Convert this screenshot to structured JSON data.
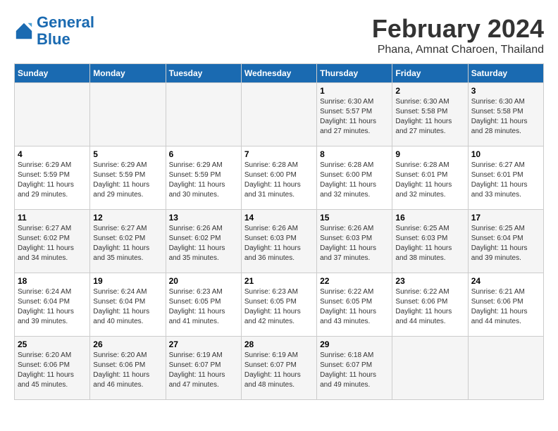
{
  "logo": {
    "text_general": "General",
    "text_blue": "Blue"
  },
  "title": "February 2024",
  "subtitle": "Phana, Amnat Charoen, Thailand",
  "weekdays": [
    "Sunday",
    "Monday",
    "Tuesday",
    "Wednesday",
    "Thursday",
    "Friday",
    "Saturday"
  ],
  "weeks": [
    [
      {
        "day": "",
        "info": ""
      },
      {
        "day": "",
        "info": ""
      },
      {
        "day": "",
        "info": ""
      },
      {
        "day": "",
        "info": ""
      },
      {
        "day": "1",
        "info": "Sunrise: 6:30 AM\nSunset: 5:57 PM\nDaylight: 11 hours and 27 minutes."
      },
      {
        "day": "2",
        "info": "Sunrise: 6:30 AM\nSunset: 5:58 PM\nDaylight: 11 hours and 27 minutes."
      },
      {
        "day": "3",
        "info": "Sunrise: 6:30 AM\nSunset: 5:58 PM\nDaylight: 11 hours and 28 minutes."
      }
    ],
    [
      {
        "day": "4",
        "info": "Sunrise: 6:29 AM\nSunset: 5:59 PM\nDaylight: 11 hours and 29 minutes."
      },
      {
        "day": "5",
        "info": "Sunrise: 6:29 AM\nSunset: 5:59 PM\nDaylight: 11 hours and 29 minutes."
      },
      {
        "day": "6",
        "info": "Sunrise: 6:29 AM\nSunset: 5:59 PM\nDaylight: 11 hours and 30 minutes."
      },
      {
        "day": "7",
        "info": "Sunrise: 6:28 AM\nSunset: 6:00 PM\nDaylight: 11 hours and 31 minutes."
      },
      {
        "day": "8",
        "info": "Sunrise: 6:28 AM\nSunset: 6:00 PM\nDaylight: 11 hours and 32 minutes."
      },
      {
        "day": "9",
        "info": "Sunrise: 6:28 AM\nSunset: 6:01 PM\nDaylight: 11 hours and 32 minutes."
      },
      {
        "day": "10",
        "info": "Sunrise: 6:27 AM\nSunset: 6:01 PM\nDaylight: 11 hours and 33 minutes."
      }
    ],
    [
      {
        "day": "11",
        "info": "Sunrise: 6:27 AM\nSunset: 6:02 PM\nDaylight: 11 hours and 34 minutes."
      },
      {
        "day": "12",
        "info": "Sunrise: 6:27 AM\nSunset: 6:02 PM\nDaylight: 11 hours and 35 minutes."
      },
      {
        "day": "13",
        "info": "Sunrise: 6:26 AM\nSunset: 6:02 PM\nDaylight: 11 hours and 35 minutes."
      },
      {
        "day": "14",
        "info": "Sunrise: 6:26 AM\nSunset: 6:03 PM\nDaylight: 11 hours and 36 minutes."
      },
      {
        "day": "15",
        "info": "Sunrise: 6:26 AM\nSunset: 6:03 PM\nDaylight: 11 hours and 37 minutes."
      },
      {
        "day": "16",
        "info": "Sunrise: 6:25 AM\nSunset: 6:03 PM\nDaylight: 11 hours and 38 minutes."
      },
      {
        "day": "17",
        "info": "Sunrise: 6:25 AM\nSunset: 6:04 PM\nDaylight: 11 hours and 39 minutes."
      }
    ],
    [
      {
        "day": "18",
        "info": "Sunrise: 6:24 AM\nSunset: 6:04 PM\nDaylight: 11 hours and 39 minutes."
      },
      {
        "day": "19",
        "info": "Sunrise: 6:24 AM\nSunset: 6:04 PM\nDaylight: 11 hours and 40 minutes."
      },
      {
        "day": "20",
        "info": "Sunrise: 6:23 AM\nSunset: 6:05 PM\nDaylight: 11 hours and 41 minutes."
      },
      {
        "day": "21",
        "info": "Sunrise: 6:23 AM\nSunset: 6:05 PM\nDaylight: 11 hours and 42 minutes."
      },
      {
        "day": "22",
        "info": "Sunrise: 6:22 AM\nSunset: 6:05 PM\nDaylight: 11 hours and 43 minutes."
      },
      {
        "day": "23",
        "info": "Sunrise: 6:22 AM\nSunset: 6:06 PM\nDaylight: 11 hours and 44 minutes."
      },
      {
        "day": "24",
        "info": "Sunrise: 6:21 AM\nSunset: 6:06 PM\nDaylight: 11 hours and 44 minutes."
      }
    ],
    [
      {
        "day": "25",
        "info": "Sunrise: 6:20 AM\nSunset: 6:06 PM\nDaylight: 11 hours and 45 minutes."
      },
      {
        "day": "26",
        "info": "Sunrise: 6:20 AM\nSunset: 6:06 PM\nDaylight: 11 hours and 46 minutes."
      },
      {
        "day": "27",
        "info": "Sunrise: 6:19 AM\nSunset: 6:07 PM\nDaylight: 11 hours and 47 minutes."
      },
      {
        "day": "28",
        "info": "Sunrise: 6:19 AM\nSunset: 6:07 PM\nDaylight: 11 hours and 48 minutes."
      },
      {
        "day": "29",
        "info": "Sunrise: 6:18 AM\nSunset: 6:07 PM\nDaylight: 11 hours and 49 minutes."
      },
      {
        "day": "",
        "info": ""
      },
      {
        "day": "",
        "info": ""
      }
    ]
  ]
}
